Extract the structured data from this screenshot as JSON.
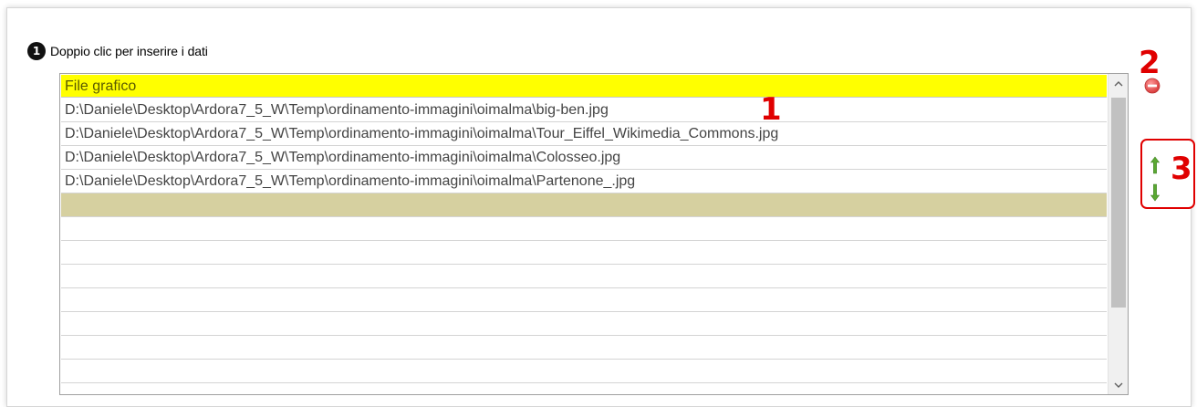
{
  "step": {
    "number": "1",
    "label": "Doppio clic per inserire i dati"
  },
  "grid": {
    "header": "File grafico",
    "rows": [
      "D:\\Daniele\\Desktop\\Ardora7_5_W\\Temp\\ordinamento-immagini\\oimalma\\big-ben.jpg",
      "D:\\Daniele\\Desktop\\Ardora7_5_W\\Temp\\ordinamento-immagini\\oimalma\\Tour_Eiffel_Wikimedia_Commons.jpg",
      "D:\\Daniele\\Desktop\\Ardora7_5_W\\Temp\\ordinamento-immagini\\oimalma\\Colosseo.jpg",
      "D:\\Daniele\\Desktop\\Ardora7_5_W\\Temp\\ordinamento-immagini\\oimalma\\Partenone_.jpg",
      "",
      "",
      "",
      "",
      "",
      "",
      "",
      ""
    ],
    "selected_row_index": 4
  },
  "scrollbar": {
    "up_icon": "chevron-up-icon",
    "down_icon": "chevron-down-icon"
  },
  "actions": {
    "remove_icon": "minus-circle-icon",
    "move_up_icon": "arrow-up-icon",
    "move_down_icon": "arrow-down-icon"
  },
  "callouts": {
    "one": "1",
    "two": "2",
    "three": "3"
  },
  "colors": {
    "header_bg": "#ffff00",
    "selected_row_bg": "#d6d0a0",
    "callout_red": "#e00000",
    "arrow_green": "#5aa832",
    "remove_red": "#e05050"
  }
}
